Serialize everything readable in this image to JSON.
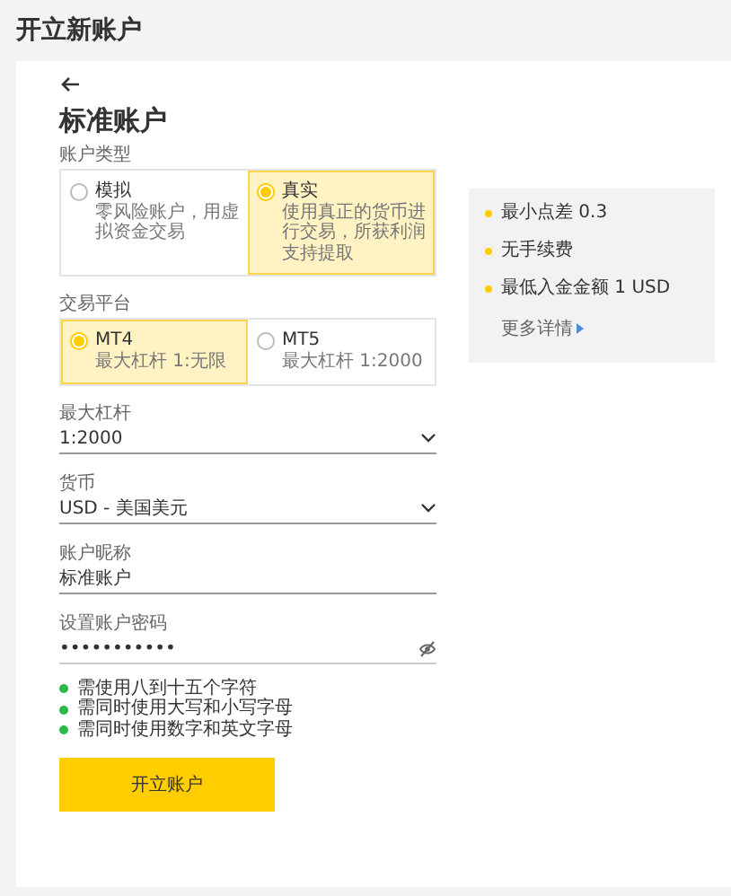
{
  "page_title": "开立新账户",
  "form_title": "标准账户",
  "account_type": {
    "label": "账户类型",
    "options": [
      {
        "title": "模拟",
        "description": "零风险账户，用虚拟资金交易",
        "selected": false
      },
      {
        "title": "真实",
        "description": "使用真正的货币进行交易，所获利润支持提取",
        "selected": true
      }
    ]
  },
  "platform": {
    "label": "交易平台",
    "options": [
      {
        "title": "MT4",
        "description": "最大杠杆 1:无限",
        "selected": true
      },
      {
        "title": "MT5",
        "description": "最大杠杆 1:2000",
        "selected": false
      }
    ]
  },
  "fields": [
    {
      "kind": "select",
      "label": "最大杠杆",
      "value": "1:2000"
    },
    {
      "kind": "select",
      "label": "货币",
      "value": "USD - 美国美元"
    },
    {
      "kind": "text",
      "label": "账户昵称",
      "value": "标准账户"
    },
    {
      "kind": "password",
      "label": "设置账户密码",
      "value": "•••••••••••"
    }
  ],
  "password_rules": [
    {
      "text": "需使用八到十五个字符",
      "met": true
    },
    {
      "text": "需同时使用大写和小写字母",
      "met": true
    },
    {
      "text": "需同时使用数字和英文字母",
      "met": true
    }
  ],
  "submit_button": "开立账户",
  "features": [
    "最小点差 0.3",
    "无手续费",
    "最低入金金额 1 USD"
  ],
  "more_link": "更多详情"
}
